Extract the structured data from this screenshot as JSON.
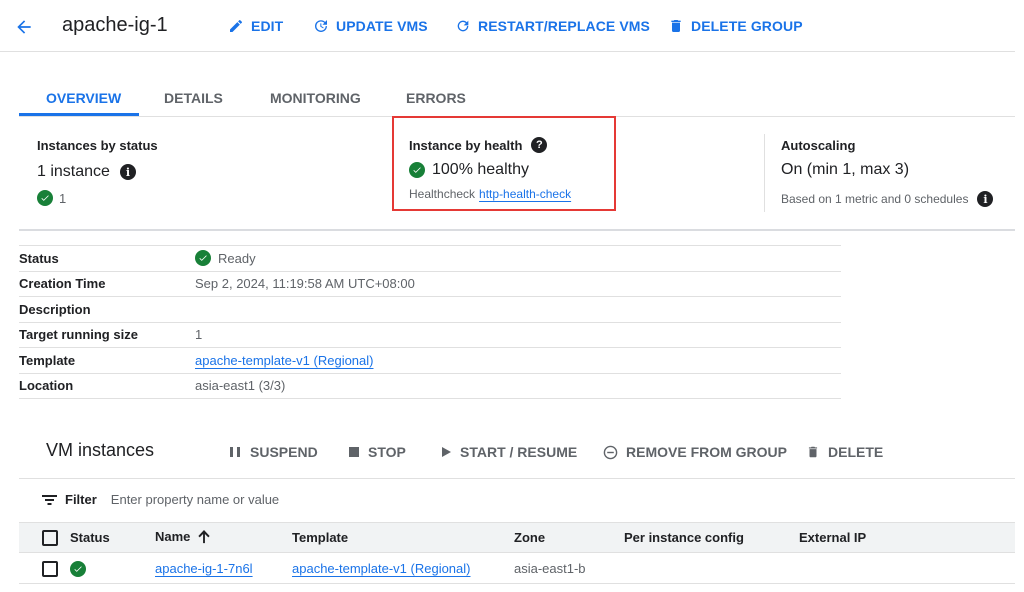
{
  "header": {
    "title": "apache-ig-1",
    "edit": "EDIT",
    "update_vms": "UPDATE VMS",
    "restart_replace": "RESTART/REPLACE VMS",
    "delete_group": "DELETE GROUP"
  },
  "tabs": [
    "OVERVIEW",
    "DETAILS",
    "MONITORING",
    "ERRORS"
  ],
  "summary": {
    "status": {
      "heading": "Instances by status",
      "count_text": "1 instance",
      "healthy_count": "1"
    },
    "health": {
      "heading": "Instance by health",
      "percent": "100% healthy",
      "healthcheck_label": "Healthcheck",
      "healthcheck_link": "http-health-check"
    },
    "autoscaling": {
      "heading": "Autoscaling",
      "value": "On (min 1, max 3)",
      "note": "Based on 1 metric and 0 schedules"
    }
  },
  "properties": [
    {
      "key": "Status",
      "value": "Ready"
    },
    {
      "key": "Creation Time",
      "value": "Sep 2, 2024, 11:19:58 AM UTC+08:00"
    },
    {
      "key": "Description",
      "value": ""
    },
    {
      "key": "Target running size",
      "value": "1"
    },
    {
      "key": "Template",
      "value": "apache-template-v1 (Regional)"
    },
    {
      "key": "Location",
      "value": "asia-east1 (3/3)"
    }
  ],
  "vm_instances": {
    "title": "VM instances",
    "actions": {
      "suspend": "SUSPEND",
      "stop": "STOP",
      "start_resume": "START / RESUME",
      "remove": "REMOVE FROM GROUP",
      "delete": "DELETE"
    },
    "filter_label": "Filter",
    "filter_placeholder": "Enter property name or value",
    "columns": [
      "Status",
      "Name",
      "Template",
      "Zone",
      "Per instance config",
      "External IP"
    ],
    "rows": [
      {
        "name": "apache-ig-1-7n6l",
        "template": "apache-template-v1 (Regional)",
        "zone": "asia-east1-b",
        "per_instance_config": "",
        "external_ip": ""
      }
    ]
  },
  "colors": {
    "accent": "#1a73e8",
    "success": "#188038",
    "highlight_border": "#e53935"
  }
}
